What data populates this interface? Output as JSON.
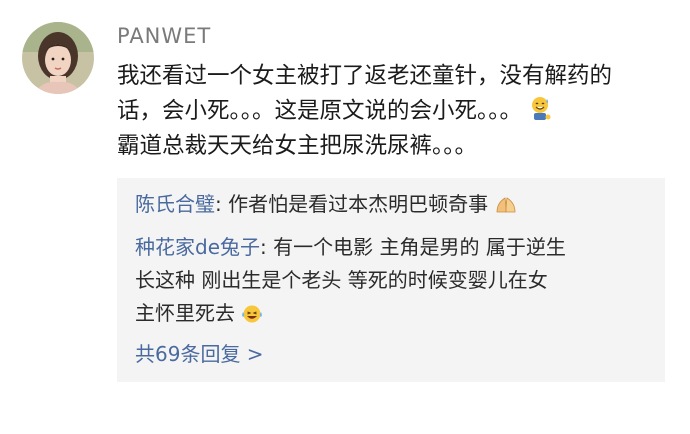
{
  "comment": {
    "username": "PANWET",
    "text_lines": [
      "我还看过一个女主被打了返老还童针，没有解药的",
      "话，会小死。。。这是原文说的会小死。。。",
      "霸道总裁天天给女主把尿洗尿裤。。。"
    ],
    "emoji": "sweat-smile-icon"
  },
  "replies": [
    {
      "user": "陈氏合璧",
      "separator": ": ",
      "lines": [
        "作者怕是看过本杰明巴顿奇事"
      ],
      "emoji": "folded-hands-icon"
    },
    {
      "user": "种花家de兔子",
      "separator": ": ",
      "lines": [
        "有一个电影  主角是男的  属于逆生",
        "长这种  刚出生是个老头  等死的时候变婴儿在女",
        "主怀里死去"
      ],
      "emoji": "laughing-tears-icon"
    }
  ],
  "more_replies_label": "共69条回复 >",
  "colors": {
    "username": "#7a7a7a",
    "text": "#1b1b1b",
    "reply_user": "#4a6a9f",
    "reply_bg": "#f4f4f4"
  }
}
